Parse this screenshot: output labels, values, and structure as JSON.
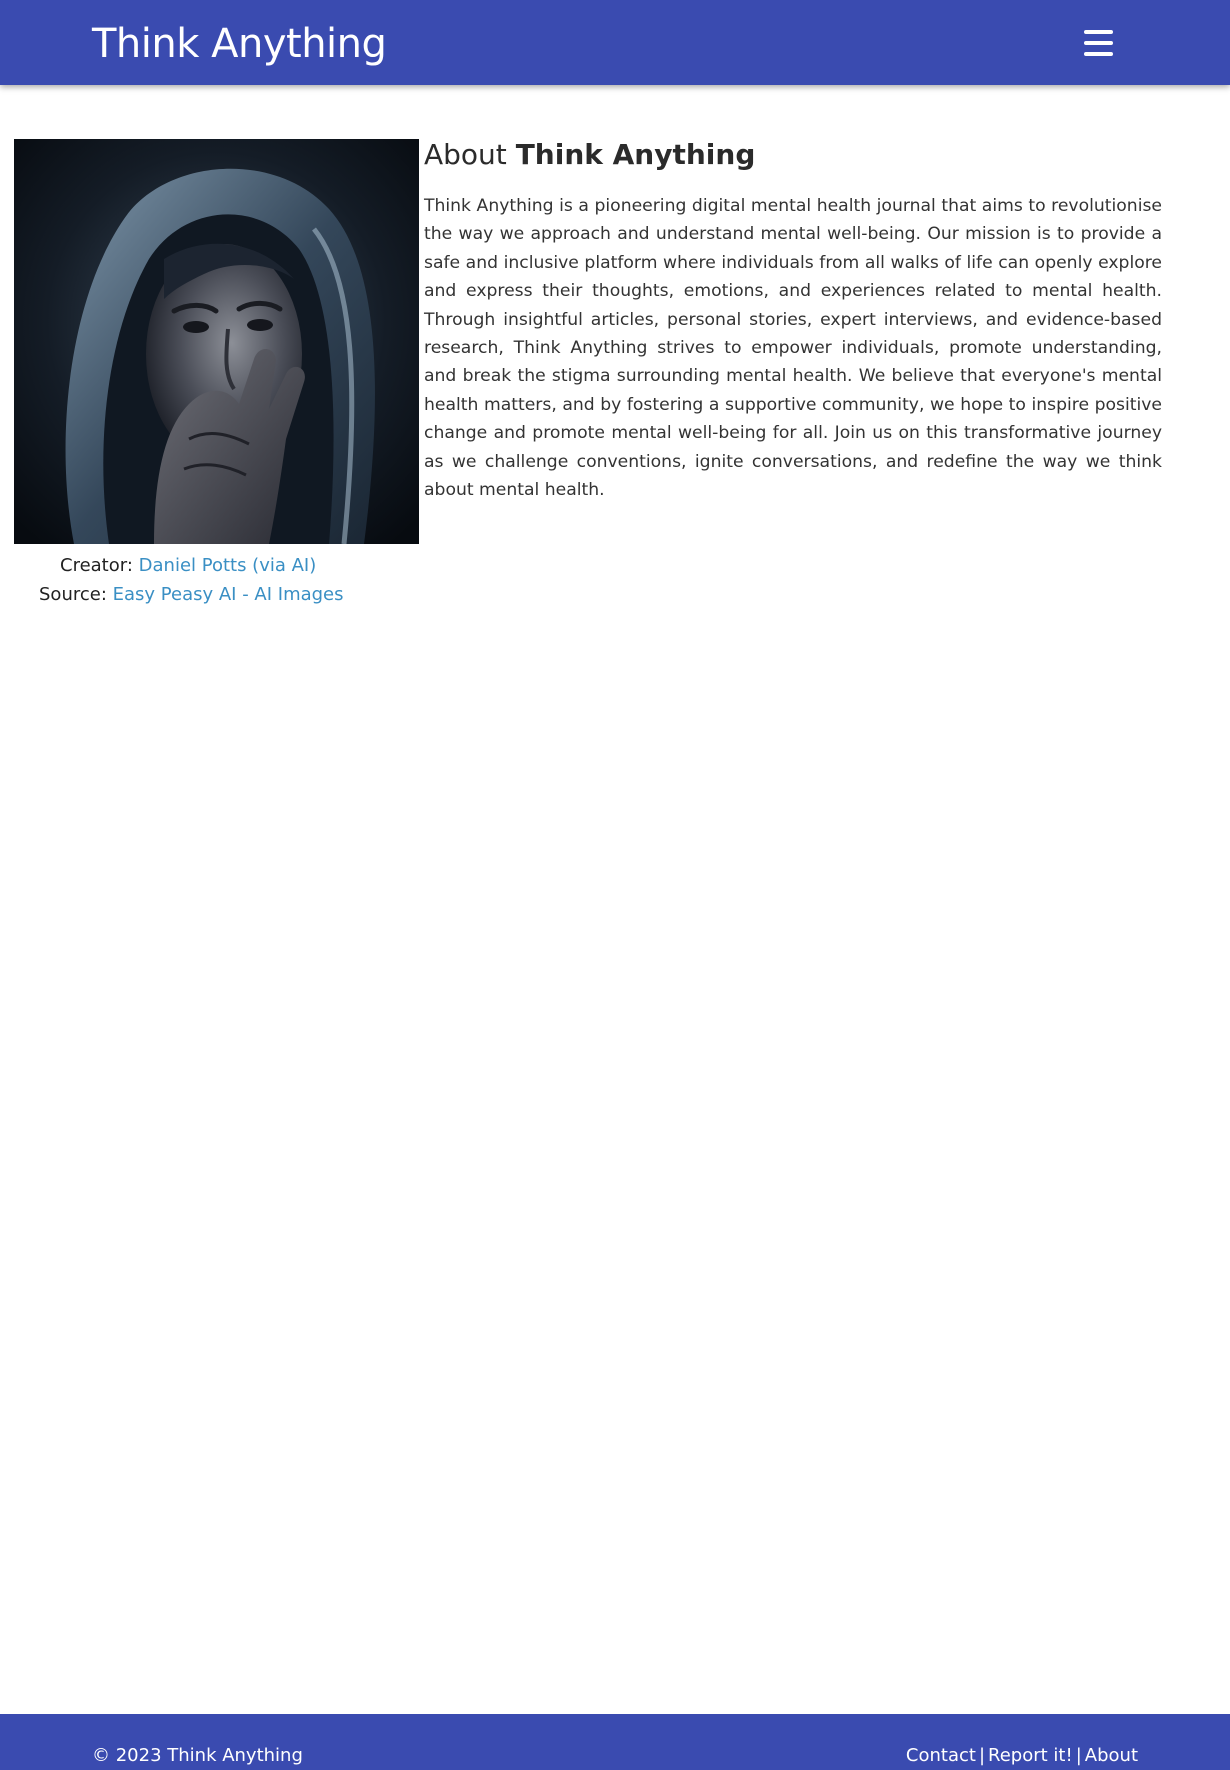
{
  "header": {
    "brand": "Think Anything",
    "menu_icon": "hamburger-menu-icon"
  },
  "image": {
    "alt": "AI-generated portrait of a person in a hood resting their hand on their face"
  },
  "credits": {
    "creator_label": "Creator:",
    "creator_value": "Daniel Potts (via AI)",
    "source_label": "Source:",
    "source_value": "Easy Peasy AI - AI Images"
  },
  "about": {
    "title_prefix": "About",
    "title_strong": "Think Anything",
    "body": "Think Anything is a pioneering digital mental health journal that aims to revolutionise the way we approach and understand mental well-being. Our mission is to provide a safe and inclusive platform where individuals from all walks of life can openly explore and express their thoughts, emotions, and experiences related to mental health. Through insightful articles, personal stories, expert interviews, and evidence-based research, Think Anything strives to empower individuals, promote understanding, and break the stigma surrounding mental health. We believe that everyone's mental health matters, and by fostering a supportive community, we hope to inspire positive change and promote mental well-being for all. Join us on this transformative journey as we challenge conventions, ignite conversations, and redefine the way we think about mental health."
  },
  "footer": {
    "copyright": "© 2023 Think Anything",
    "links": [
      "Contact",
      "Report it!",
      "About"
    ],
    "separator": "|"
  },
  "colors": {
    "header_bg": "#3a4bb0",
    "link": "#3a8fc4",
    "text": "#2b2b2b"
  }
}
